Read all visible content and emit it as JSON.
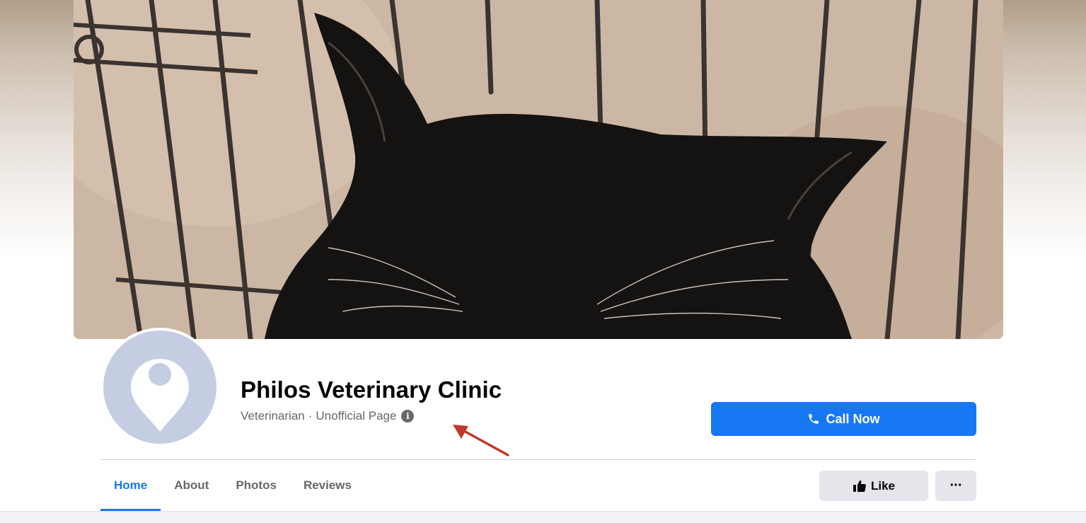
{
  "profile": {
    "name": "Philos Veterinary Clinic",
    "category": "Veterinarian",
    "separator": "·",
    "page_status": "Unofficial Page",
    "info_icon_glyph": "i"
  },
  "actions": {
    "call_label": "Call Now",
    "like_label": "Like",
    "more_label": "···"
  },
  "tabs": [
    {
      "label": "Home",
      "active": true
    },
    {
      "label": "About",
      "active": false
    },
    {
      "label": "Photos",
      "active": false
    },
    {
      "label": "Reviews",
      "active": false
    }
  ],
  "icons": {
    "avatar": "location-pin-icon",
    "info": "info-icon",
    "call": "phone-icon",
    "like": "thumbs-up-icon",
    "annotation": "red-arrow-icon"
  },
  "colors": {
    "accent": "#1877f2",
    "secondary_text": "#65676b",
    "button_gray": "#e4e6eb",
    "avatar_bg": "#c5cde3",
    "annotation_arrow": "#c0392b"
  }
}
